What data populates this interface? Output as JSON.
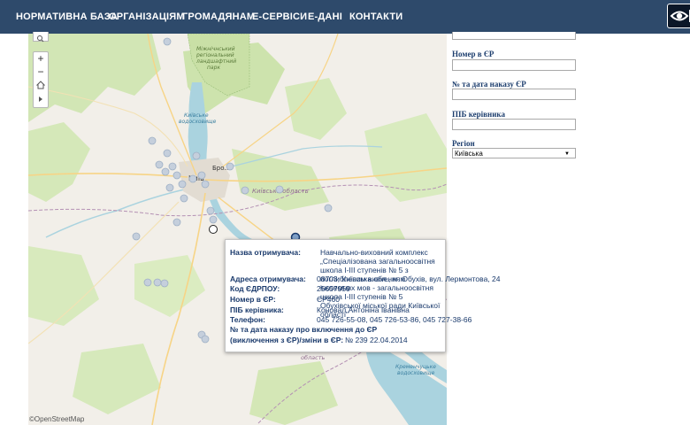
{
  "nav": {
    "items": [
      "НОРМАТИВНА БАЗА",
      "ОРГАНІЗАЦІЯМ",
      "ГРОМАДЯНАМ",
      "Е-СЕРВІСИ",
      "Е-ДАНІ",
      "КОНТАКТИ"
    ],
    "accessibility_icon": "eye-icon"
  },
  "map": {
    "labels": {
      "reserve": [
        "Міжнічнський",
        "регіональний",
        "ландшафтний",
        "парк"
      ],
      "reservoir": [
        "Київське",
        "водосховище"
      ],
      "city": "Київ",
      "brovary": "Бро...",
      "oblast_label": "Київська область",
      "lower_oblast": [
        "...ькі...",
        "область"
      ],
      "kremenchuk": [
        "Кременчуцьке",
        "водосховище"
      ]
    },
    "attribution": "©OpenStreetMap",
    "zoom_in": "+",
    "zoom_out": "−"
  },
  "form": {
    "fields": [
      {
        "label": "Номер в ЄР",
        "value": ""
      },
      {
        "label": "№ та дата наказу  ЄР",
        "value": ""
      },
      {
        "label": "ПІБ керівника",
        "value": ""
      }
    ],
    "region_label": "Регіон",
    "region_value": "Київська"
  },
  "popup": {
    "name_label": "Назва отримувача:",
    "name_value": "Навчально-виховний комплекс „Спеціалізована загальноосвітня школа І-ІІІ ступенів № 5 з поглибленим вивченням іноземних мов - загальноосвітня школа І-ІІІ ступенів № 5 Обухівської міської ради Київської області\"",
    "address_label": "Адреса отримувача:",
    "address_value_1": "08703, Київська обл., м. Обухів, вул. Лермонтова, 24",
    "edrpou_label": "Код ЄДРПОУ:",
    "edrpou_value": "25657959",
    "er_number_label": "Номер в ЄР:",
    "er_number_value": "ЄР460",
    "head_label": "ПІБ керівника:",
    "head_value": "Коновал Антоніна Іванівна",
    "phone_label": "Телефон:",
    "phone_value": "045 726-55-08, 045 726-53-86, 045 727-38-66",
    "order_label_1": "№ та дата наказу про включення до ЄР",
    "order_label_2": "(виключення з ЄР)/зміни в ЄР:",
    "order_value": "№ 239 22.04.2014"
  },
  "colors": {
    "nav_bg": "#2e4a6b",
    "label_blue": "#1a3a6c",
    "marker_fill": "#c5cfdc",
    "water": "#aad3df",
    "forest": "#cfe5b0"
  }
}
